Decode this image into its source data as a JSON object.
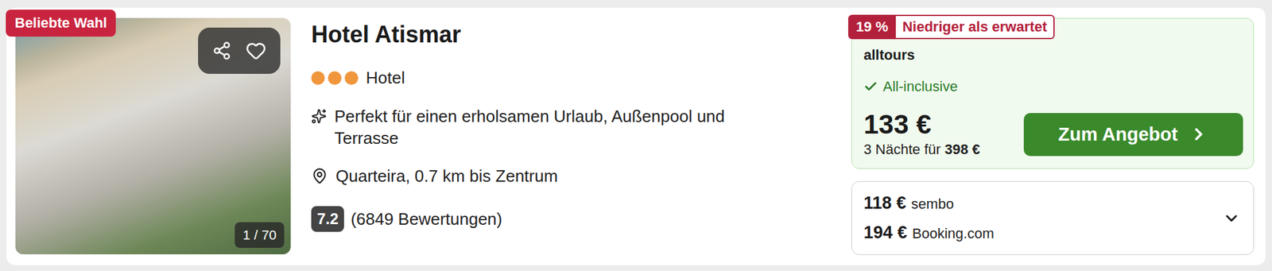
{
  "listing": {
    "badge": "Beliebte Wahl",
    "photo_counter": "1 / 70",
    "title": "Hotel Atismar",
    "stars": 3,
    "type": "Hotel",
    "description": "Perfekt für einen erholsamen Urlaub, Außenpool und Terrasse",
    "location": "Quarteira, 0.7 km bis Zentrum",
    "rating": "7.2",
    "reviews": "(6849 Bewertungen)",
    "favorite": false
  },
  "deal": {
    "discount": "19 %",
    "discount_label": "Niedriger als erwartet",
    "provider": "alltours",
    "feature": "All-inclusive",
    "price": "133 €",
    "nights": "3 Nächte für",
    "total": "398 €",
    "button": "Zum Angebot"
  },
  "other_offers": [
    {
      "price": "118 €",
      "provider": "sembo"
    },
    {
      "price": "194 €",
      "provider": "Booking.com"
    }
  ],
  "other_offers_expanded": false
}
